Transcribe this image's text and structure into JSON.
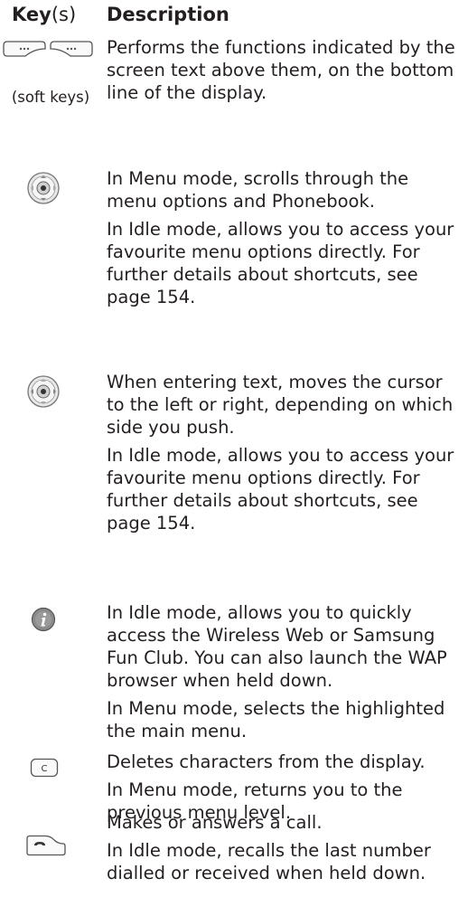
{
  "header": {
    "key_bold": "Key",
    "key_suffix": "(s)",
    "description": "Description"
  },
  "rows": [
    {
      "icon": "soft-keys-icon",
      "caption": "(soft keys)",
      "paragraphs": [
        "Performs the functions indicated by the screen text above them, on the bottom line of the display."
      ]
    },
    {
      "icon": "navigation-key-up-down-icon",
      "paragraphs": [
        "In Menu mode, scrolls through the menu options and Phonebook.",
        "In Idle mode, allows you to access your favourite menu options directly. For further details about shortcuts, see page 154."
      ]
    },
    {
      "icon": "navigation-key-left-right-icon",
      "paragraphs": [
        "When entering text, moves the cursor to the left or right, depending on which side you push.",
        "In Idle mode, allows you to access your favourite menu options directly. For further details about shortcuts, see page 154."
      ]
    },
    {
      "icon": "info-key-icon",
      "paragraphs": [
        "In Idle mode, allows you to quickly access the Wireless Web or Samsung Fun Club. You can also launch the WAP browser when held down.",
        "In Menu mode, selects the highlighted the main menu."
      ]
    },
    {
      "icon": "clear-key-icon",
      "icon_text": "C",
      "paragraphs": [
        "Deletes characters from the display.",
        "In Menu mode, returns you to the previous menu level."
      ]
    },
    {
      "icon": "dial-key-icon",
      "paragraphs": [
        "Makes or answers a call.",
        "In Idle mode, recalls the last number dialled or received when held down."
      ]
    }
  ]
}
